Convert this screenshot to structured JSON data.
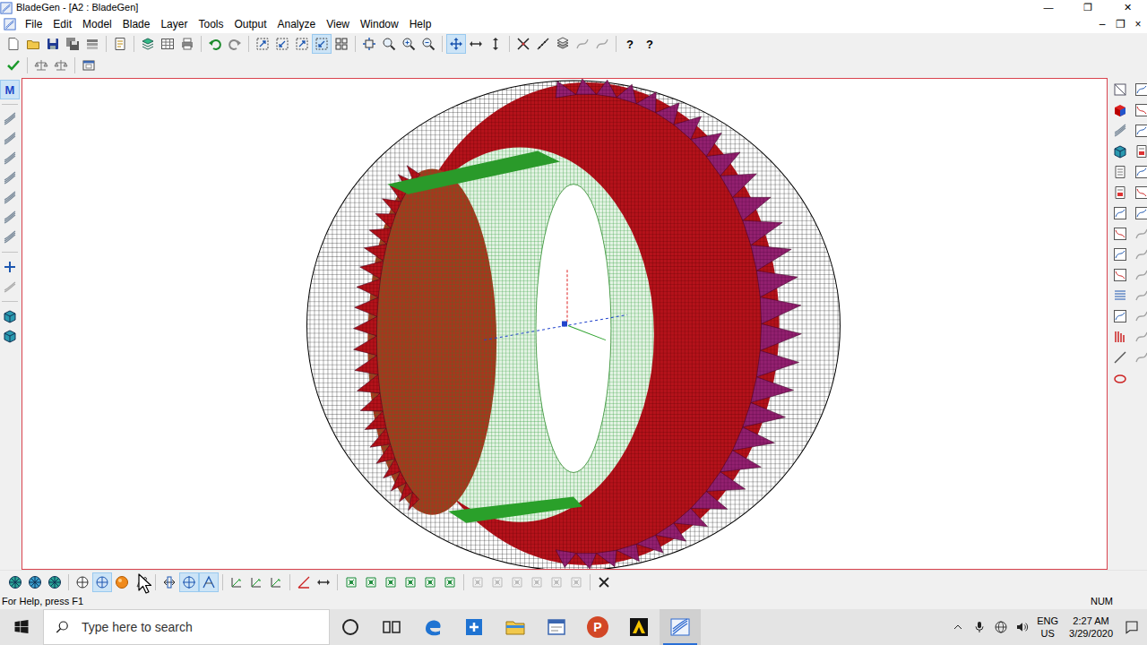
{
  "window": {
    "title": "BladeGen - [A2 : BladeGen]",
    "controls": [
      "—",
      "❐",
      "✕"
    ]
  },
  "menu": {
    "items": [
      "File",
      "Edit",
      "Model",
      "Blade",
      "Layer",
      "Tools",
      "Output",
      "Analyze",
      "View",
      "Window",
      "Help"
    ],
    "controls": [
      "–",
      "❐",
      "×"
    ]
  },
  "toolbar_top": {
    "groups": [
      [
        {
          "selected": false,
          "disabled": false
        },
        {
          "selected": false,
          "disabled": false
        },
        {
          "selected": false,
          "disabled": false
        },
        {
          "selected": false,
          "disabled": false
        },
        {
          "selected": false,
          "disabled": false
        }
      ],
      [
        {
          "selected": false,
          "disabled": false
        }
      ],
      [
        {
          "selected": false,
          "disabled": false
        },
        {
          "selected": false,
          "disabled": false
        },
        {
          "selected": false,
          "disabled": false
        }
      ],
      [
        {
          "selected": false,
          "disabled": false
        },
        {
          "selected": false,
          "disabled": false
        }
      ],
      [
        {
          "selected": false,
          "disabled": false
        },
        {
          "selected": false,
          "disabled": false
        },
        {
          "selected": false,
          "disabled": false
        },
        {
          "selected": true,
          "disabled": false
        },
        {
          "selected": false,
          "disabled": false
        }
      ],
      [
        {
          "selected": false,
          "disabled": false
        },
        {
          "selected": false,
          "disabled": false
        },
        {
          "selected": false,
          "disabled": false
        },
        {
          "selected": false,
          "disabled": false
        }
      ],
      [
        {
          "selected": true,
          "disabled": false
        },
        {
          "selected": false,
          "disabled": false
        },
        {
          "selected": false,
          "disabled": false
        }
      ],
      [
        {
          "selected": false,
          "disabled": false
        },
        {
          "selected": false,
          "disabled": false
        },
        {
          "selected": false,
          "disabled": false
        },
        {
          "selected": false,
          "disabled": true
        },
        {
          "selected": false,
          "disabled": true
        }
      ],
      [
        {
          "selected": false,
          "disabled": false,
          "label": "?"
        },
        {
          "selected": false,
          "disabled": false,
          "label": "?"
        }
      ]
    ]
  },
  "toolbar_second": {
    "groups": [
      [
        {
          "selected": false,
          "disabled": false
        }
      ],
      [
        {
          "selected": false,
          "disabled": false
        },
        {
          "selected": false,
          "disabled": false
        }
      ],
      [
        {
          "selected": false,
          "disabled": false
        }
      ]
    ]
  },
  "toolbar_left": {
    "groups": [
      [
        {
          "selected": true,
          "disabled": false,
          "label": "M"
        }
      ],
      [
        {
          "selected": false,
          "disabled": false
        },
        {
          "selected": false,
          "disabled": false
        },
        {
          "selected": false,
          "disabled": false
        },
        {
          "selected": false,
          "disabled": false
        },
        {
          "selected": false,
          "disabled": false
        },
        {
          "selected": false,
          "disabled": false
        },
        {
          "selected": false,
          "disabled": false
        }
      ],
      [
        {
          "selected": false,
          "disabled": false
        },
        {
          "selected": false,
          "disabled": false
        }
      ],
      [
        {
          "selected": false,
          "disabled": false
        },
        {
          "selected": false,
          "disabled": false
        }
      ]
    ]
  },
  "toolbar_right": {
    "columns": [
      [
        {
          "selected": false,
          "disabled": false
        },
        {
          "selected": false,
          "disabled": false
        },
        {
          "selected": false,
          "disabled": false
        },
        {
          "selected": false,
          "disabled": false
        },
        {
          "selected": false,
          "disabled": false
        },
        {
          "selected": false,
          "disabled": false
        },
        {
          "selected": false,
          "disabled": false
        },
        {
          "selected": false,
          "disabled": false
        },
        {
          "selected": false,
          "disabled": false
        },
        {
          "selected": false,
          "disabled": false
        },
        {
          "selected": false,
          "disabled": false
        },
        {
          "selected": false,
          "disabled": false
        },
        {
          "selected": false,
          "disabled": false
        },
        {
          "selected": false,
          "disabled": false
        },
        {
          "selected": false,
          "disabled": false
        }
      ],
      [
        {
          "selected": false,
          "disabled": false
        },
        {
          "selected": false,
          "disabled": false
        },
        {
          "selected": false,
          "disabled": false
        },
        {
          "selected": false,
          "disabled": false
        },
        {
          "selected": false,
          "disabled": false
        },
        {
          "selected": false,
          "disabled": false
        },
        {
          "selected": false,
          "disabled": false
        },
        {
          "selected": false,
          "disabled": true
        },
        {
          "selected": false,
          "disabled": true
        },
        {
          "selected": false,
          "disabled": true
        },
        {
          "selected": false,
          "disabled": true
        },
        {
          "selected": false,
          "disabled": true
        },
        {
          "selected": false,
          "disabled": true
        },
        {
          "selected": false,
          "disabled": true
        }
      ]
    ]
  },
  "toolbar_bottom": {
    "groups": [
      [
        {
          "selected": false,
          "disabled": false
        },
        {
          "selected": false,
          "disabled": false
        },
        {
          "selected": false,
          "disabled": false
        }
      ],
      [
        {
          "selected": false,
          "disabled": false
        },
        {
          "selected": true,
          "disabled": false
        },
        {
          "selected": false,
          "disabled": false
        },
        {
          "selected": false,
          "disabled": false
        }
      ],
      [
        {
          "selected": false,
          "disabled": false
        },
        {
          "selected": true,
          "disabled": false
        },
        {
          "selected": true,
          "disabled": false
        }
      ],
      [
        {
          "selected": false,
          "disabled": false
        },
        {
          "selected": false,
          "disabled": false
        },
        {
          "selected": false,
          "disabled": false
        }
      ],
      [
        {
          "selected": false,
          "disabled": false
        },
        {
          "selected": false,
          "disabled": false
        }
      ],
      [
        {
          "selected": false,
          "disabled": false
        },
        {
          "selected": false,
          "disabled": false
        },
        {
          "selected": false,
          "disabled": false
        },
        {
          "selected": false,
          "disabled": false
        },
        {
          "selected": false,
          "disabled": false
        },
        {
          "selected": false,
          "disabled": false
        }
      ],
      [
        {
          "selected": false,
          "disabled": true
        },
        {
          "selected": false,
          "disabled": true
        },
        {
          "selected": false,
          "disabled": true
        },
        {
          "selected": false,
          "disabled": true
        },
        {
          "selected": false,
          "disabled": true
        },
        {
          "selected": false,
          "disabled": true
        }
      ],
      [
        {
          "selected": false,
          "disabled": false
        }
      ]
    ]
  },
  "status_bar": {
    "help": "For Help, press F1",
    "indicator": "NUM"
  },
  "taskbar": {
    "search_placeholder": "Type here to search",
    "apps": [
      {
        "selected": false
      },
      {
        "selected": false
      },
      {
        "selected": false
      },
      {
        "selected": false
      },
      {
        "selected": false
      },
      {
        "selected": false
      },
      {
        "selected": false,
        "label": "P"
      },
      {
        "selected": false
      },
      {
        "selected": true
      }
    ],
    "tray": {
      "language": "ENG",
      "region": "US",
      "time": "2:27 AM",
      "date": "3/29/2020"
    }
  }
}
